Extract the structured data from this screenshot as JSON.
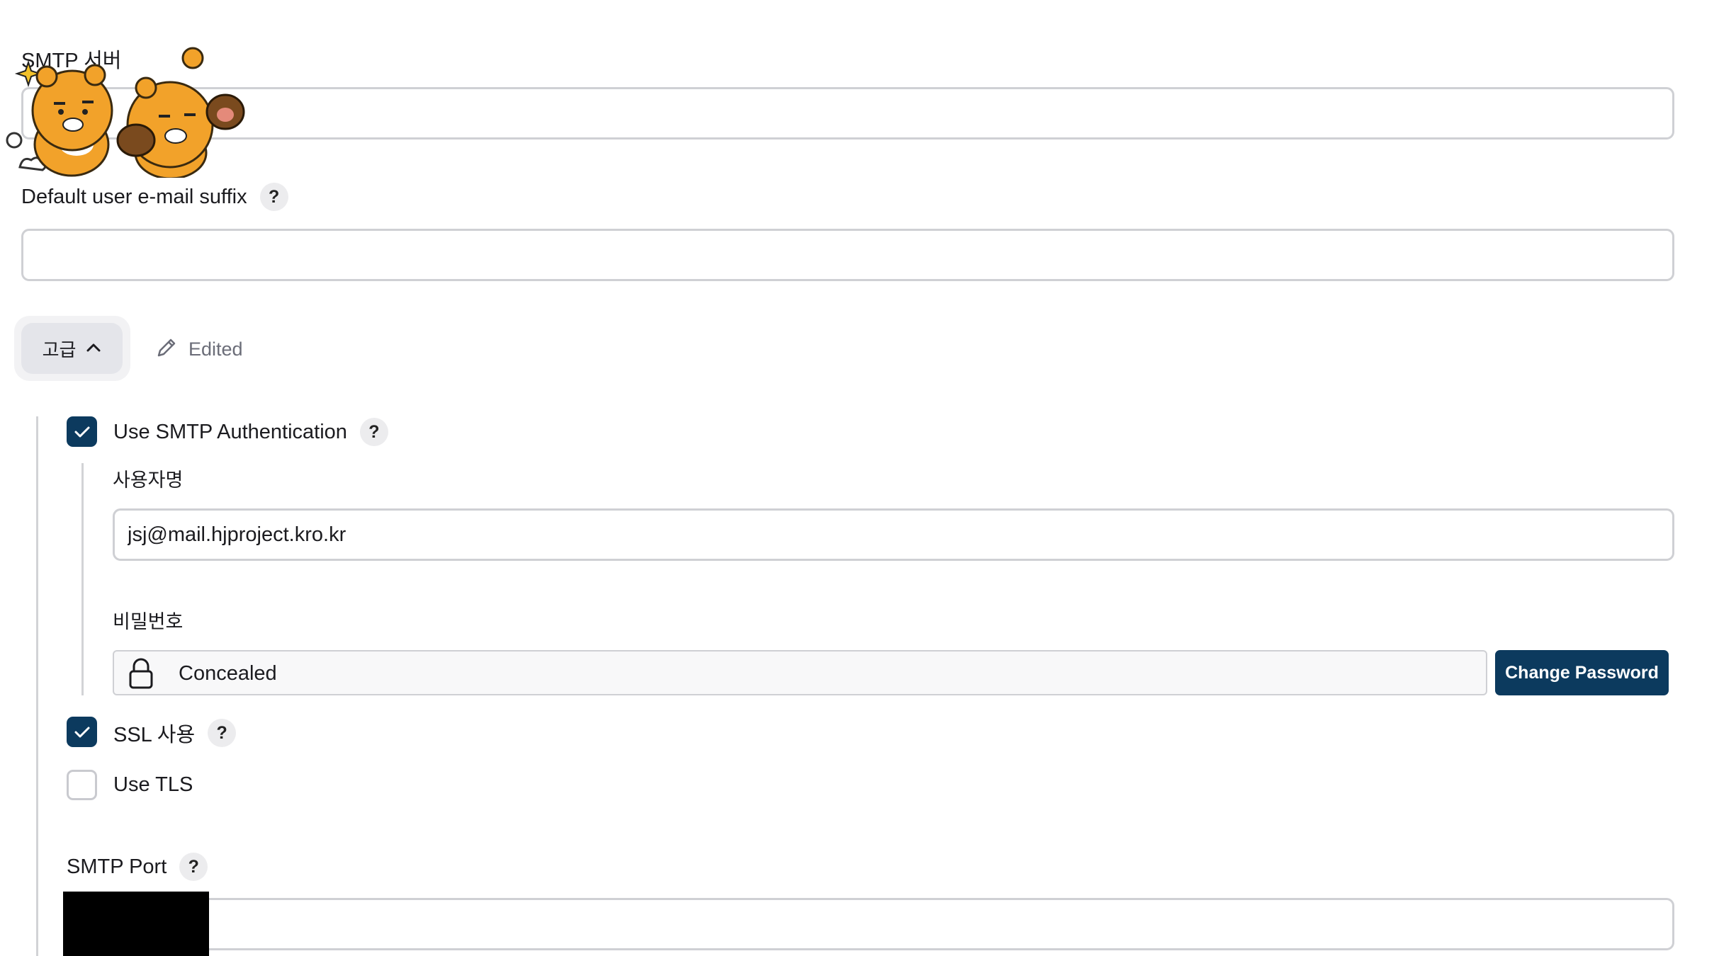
{
  "smtp_server": {
    "label": "SMTP 서버",
    "value": ""
  },
  "email_suffix": {
    "label": "Default user e-mail suffix",
    "value": ""
  },
  "help_glyph": "?",
  "advanced": {
    "label": "고급",
    "edited_label": "Edited"
  },
  "smtp_auth": {
    "label": "Use SMTP Authentication",
    "checked": true,
    "username_label": "사용자명",
    "username_value": "jsj@mail.hjproject.kro.kr",
    "password_label": "비밀번호",
    "password_status": "Concealed",
    "change_password_label": "Change Password"
  },
  "ssl": {
    "label": "SSL 사용",
    "checked": true
  },
  "tls": {
    "label": "Use TLS",
    "checked": false
  },
  "smtp_port": {
    "label": "SMTP Port",
    "value": ""
  },
  "colors": {
    "accent": "#0c3a5e",
    "border": "#cfd0d4",
    "sticker": "#f2a22a"
  }
}
